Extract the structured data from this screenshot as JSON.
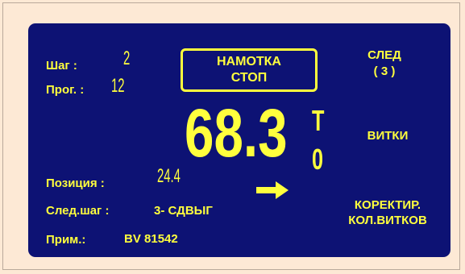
{
  "step": {
    "label": "Шаг :",
    "value": "2"
  },
  "program": {
    "label": "Прог. :",
    "value": "12"
  },
  "status": {
    "line1": "НАМОТКА",
    "line2": "СТОП"
  },
  "counter": {
    "value": "68.3",
    "unit_top": "T",
    "unit_bottom": "0"
  },
  "position": {
    "label": "Позиция :",
    "value": "24.4"
  },
  "next_step": {
    "label": "След.шаг :",
    "value": "3- СДВЫГ"
  },
  "note": {
    "label": "Прим.:",
    "value": "BV 81542"
  },
  "buttons": {
    "next_line1": "СЛЕД",
    "next_line2": "( 3 )",
    "turns": "ВИТКИ",
    "correct_line1": "КОРЕКТИР.",
    "correct_line2": "КОЛ.ВИТКОВ"
  },
  "colors": {
    "panel": "#0d1274",
    "text": "#ffff3d",
    "page": "#fde9d5"
  },
  "icons": {
    "direction": "arrow-right-icon"
  }
}
